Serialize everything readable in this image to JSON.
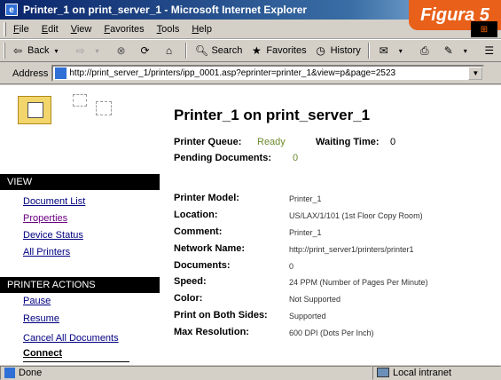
{
  "window": {
    "title": "Printer_1 on print_server_1 - Microsoft Internet Explorer",
    "badge": "Figura 5"
  },
  "menubar": {
    "items": [
      "File",
      "Edit",
      "View",
      "Favorites",
      "Tools",
      "Help"
    ]
  },
  "toolbar": {
    "back": "Back",
    "search": "Search",
    "favorites": "Favorites",
    "history": "History"
  },
  "address": {
    "label": "Address",
    "url": "http://print_server_1/printers/ipp_0001.asp?eprinter=printer_1&view=p&page=2523"
  },
  "sidebar": {
    "view_heading": "VIEW",
    "view_links": [
      "Document List",
      "Properties",
      "Device Status",
      "All Printers"
    ],
    "actions_heading": "PRINTER ACTIONS",
    "action_links": [
      "Pause",
      "Resume",
      "Cancel All Documents",
      "Connect"
    ]
  },
  "main": {
    "title": "Printer_1 on print_server_1",
    "queue_label": "Printer Queue:",
    "queue_value": "Ready",
    "waiting_label": "Waiting Time:",
    "waiting_value": "0",
    "pending_label": "Pending Documents:",
    "pending_value": "0",
    "properties": [
      {
        "label": "Printer Model:",
        "value": "Printer_1"
      },
      {
        "label": "Location:",
        "value": "US/LAX/1/101  (1st Floor Copy Room)"
      },
      {
        "label": "Comment:",
        "value": "Printer_1"
      },
      {
        "label": "Network Name:",
        "value": "http://print_server1/printers/printer1"
      },
      {
        "label": "Documents:",
        "value": "0"
      },
      {
        "label": "Speed:",
        "value": "24 PPM (Number of Pages Per Minute)"
      },
      {
        "label": "Color:",
        "value": "Not Supported"
      },
      {
        "label": "Print on Both Sides:",
        "value": "Supported"
      },
      {
        "label": "Max Resolution:",
        "value": "600 DPI (Dots Per Inch)"
      }
    ]
  },
  "status": {
    "text": "Done",
    "zone": "Local intranet"
  }
}
